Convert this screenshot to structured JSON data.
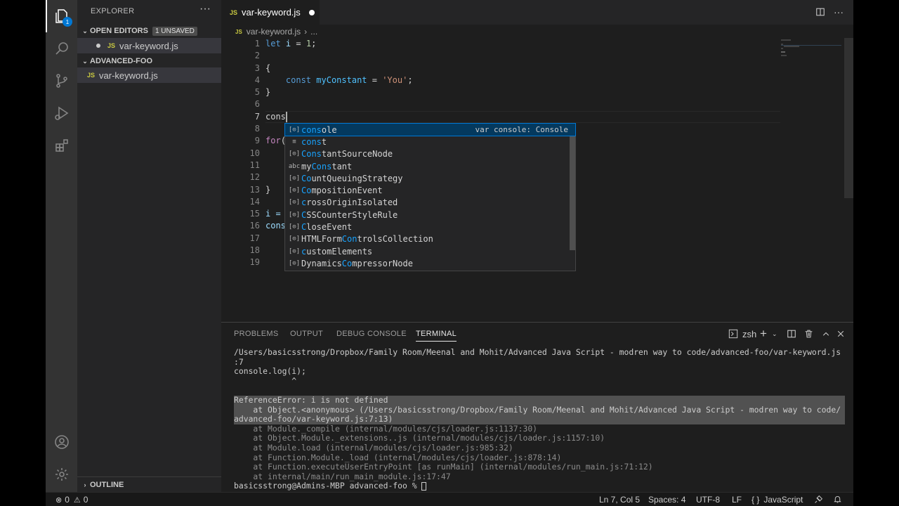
{
  "activity_bar": {
    "explorer_badge": "1"
  },
  "sidebar": {
    "title": "EXPLORER",
    "more": "···",
    "open_editors": {
      "label": "OPEN EDITORS",
      "badge": "1 UNSAVED",
      "file": "var-keyword.js"
    },
    "folder": {
      "label": "ADVANCED-FOO",
      "file": "var-keyword.js"
    },
    "outline": "OUTLINE",
    "file_icon": "JS"
  },
  "editor": {
    "tab_label": "var-keyword.js",
    "tab_icon": "JS",
    "breadcrumb_file": "var-keyword.js",
    "breadcrumb_sep": "›",
    "breadcrumb_more": "...",
    "line_numbers": [
      "1",
      "2",
      "3",
      "4",
      "5",
      "6",
      "7",
      "8",
      "9",
      "10",
      "11",
      "12",
      "13",
      "14",
      "15",
      "16",
      "17",
      "18",
      "19"
    ],
    "lines": {
      "l1_kw": "let",
      "l1_var": "i",
      "l1_rest": " = ",
      "l1_num": "1",
      "l1_end": ";",
      "l3": "{",
      "l4_kw": "const",
      "l4_var": "myConstant",
      "l4_eq": " = ",
      "l4_str": "'You'",
      "l4_end": ";",
      "l5": "}",
      "l7": "cons",
      "l9_kw": "for",
      "l9_rest": "(",
      "l13": "}",
      "l15": "i =",
      "l16": "cons"
    }
  },
  "suggest": {
    "items": [
      {
        "icon": "[⊙]",
        "pre": "",
        "match": "cons",
        "post": "ole",
        "detail": "var console: Console"
      },
      {
        "icon": "≡",
        "pre": "",
        "match": "cons",
        "post": "t",
        "detail": ""
      },
      {
        "icon": "[⊙]",
        "pre": "",
        "match": "Cons",
        "post": "tantSourceNode",
        "detail": ""
      },
      {
        "icon": "abc",
        "pre": "my",
        "match": "Cons",
        "post": "tant",
        "detail": ""
      },
      {
        "icon": "[⊙]",
        "pre": "",
        "match": "Co",
        "post": "untQueuingStrategy",
        "detail": ""
      },
      {
        "icon": "[⊙]",
        "pre": "",
        "match": "Co",
        "post": "mpositionEvent",
        "detail": ""
      },
      {
        "icon": "[⊙]",
        "pre": "",
        "match": "c",
        "post": "rossOriginIsolated",
        "detail": ""
      },
      {
        "icon": "[⊙]",
        "pre": "",
        "match": "C",
        "post": "SSCounterStyleRule",
        "detail": ""
      },
      {
        "icon": "[⊙]",
        "pre": "",
        "match": "C",
        "post": "loseEvent",
        "detail": ""
      },
      {
        "icon": "[⊙]",
        "pre": "HTMLForm",
        "match": "Con",
        "post": "trolsCollection",
        "detail": ""
      },
      {
        "icon": "[⊙]",
        "pre": "",
        "match": "c",
        "post": "ustomElements",
        "detail": ""
      },
      {
        "icon": "[⊙]",
        "pre": "Dynamics",
        "match": "Co",
        "post": "mpressorNode",
        "detail": ""
      }
    ]
  },
  "panel": {
    "tabs": [
      "PROBLEMS",
      "OUTPUT",
      "DEBUG CONSOLE",
      "TERMINAL"
    ],
    "shell": "zsh",
    "terminal_lines": [
      "/Users/basicsstrong/Dropbox/Family Room/Meenal and Mohit/Advanced Java Script - modren way to code/advanced-foo/var-keyword.js",
      ":7",
      "console.log(i);",
      "            ^",
      "",
      "ReferenceError: i is not defined",
      "    at Object.<anonymous> (/Users/basicsstrong/Dropbox/Family Room/Meenal and Mohit/Advanced Java Script - modren way to code/",
      "advanced-foo/var-keyword.js:7:13)",
      "    at Module._compile (internal/modules/cjs/loader.js:1137:30)",
      "    at Object.Module._extensions..js (internal/modules/cjs/loader.js:1157:10)",
      "    at Module.load (internal/modules/cjs/loader.js:985:32)",
      "    at Function.Module._load (internal/modules/cjs/loader.js:878:14)",
      "    at Function.executeUserEntryPoint [as runMain] (internal/modules/run_main.js:71:12)",
      "    at internal/main/run_main_module.js:17:47"
    ],
    "prompt": "basicsstrong@Admins-MBP advanced-foo % "
  },
  "status": {
    "errors": "0",
    "warnings": "0",
    "position": "Ln 7, Col 5",
    "spaces": "Spaces: 4",
    "encoding": "UTF-8",
    "eol": "LF",
    "language_icon": "{ }",
    "language": "JavaScript"
  },
  "colors": {
    "accent": "#0078d4",
    "match_highlight": "#18a3ff",
    "keyword": "#569cd6",
    "string": "#ce9178"
  }
}
